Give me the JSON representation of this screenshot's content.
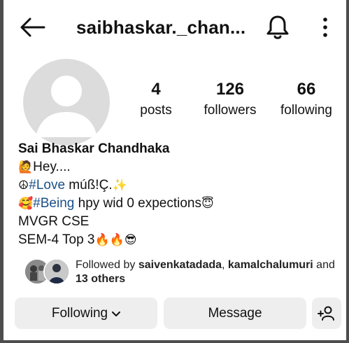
{
  "header": {
    "username": "saibhaskar._chan...",
    "icons": [
      "back-arrow-icon",
      "bell-icon",
      "more-vertical-icon"
    ]
  },
  "stats": {
    "posts_count": "4",
    "posts_label": "posts",
    "followers_count": "126",
    "followers_label": "followers",
    "following_count": "66",
    "following_label": "following"
  },
  "bio": {
    "name": "Sai Bhaskar Chandhaka",
    "line1_text": "Hey....",
    "line2_hashtag": "#Love",
    "line2_text": " múß!Ç.",
    "line3_hashtag": "#Being",
    "line3_text": " hpy wid 0 expections",
    "line4": "MVGR CSE",
    "line5": "SEM-4 Top 3"
  },
  "followed_by": {
    "prefix": "Followed by ",
    "user1": "saivenkatadada",
    "separator": ", ",
    "user2": "kamalchalumuri",
    "and_text": " and ",
    "others": "13 others"
  },
  "actions": {
    "following_label": "Following",
    "message_label": "Message"
  },
  "colors": {
    "hashtag": "#1a4f8a",
    "button_bg": "#eeeeee",
    "avatar_bg": "#dcdcdc"
  }
}
